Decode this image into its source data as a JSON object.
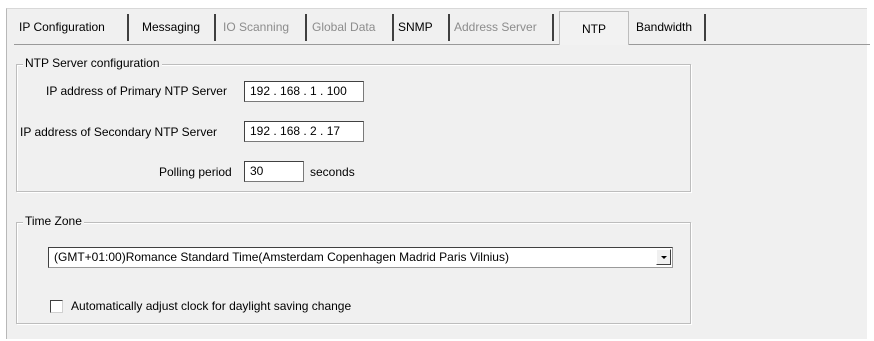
{
  "tabs": [
    {
      "label": "IP Configuration",
      "state": "normal"
    },
    {
      "label": "Messaging",
      "state": "normal"
    },
    {
      "label": "IO Scanning",
      "state": "disabled"
    },
    {
      "label": "Global Data",
      "state": "disabled"
    },
    {
      "label": "SNMP",
      "state": "normal"
    },
    {
      "label": "Address Server",
      "state": "disabled"
    },
    {
      "label": "NTP",
      "state": "active"
    },
    {
      "label": "Bandwidth",
      "state": "normal"
    }
  ],
  "ntp_server": {
    "legend": "NTP Server configuration",
    "primary_label": "IP address of Primary NTP Server",
    "primary_value": "192 . 168 . 1 . 100",
    "secondary_label": "IP address of Secondary NTP Server",
    "secondary_value": "192 . 168 . 2 . 17",
    "polling_label": "Polling period",
    "polling_value": "30",
    "polling_unit": "seconds"
  },
  "time_zone": {
    "legend": "Time Zone",
    "selected": "(GMT+01:00)Romance Standard Time(Amsterdam Copenhagen Madrid Paris Vilnius)",
    "dst_label": "Automatically adjust clock for daylight saving change",
    "dst_checked": false
  },
  "colors": {
    "panel_bg": "#f0f0f0",
    "disabled_text": "#8c8c8c"
  }
}
